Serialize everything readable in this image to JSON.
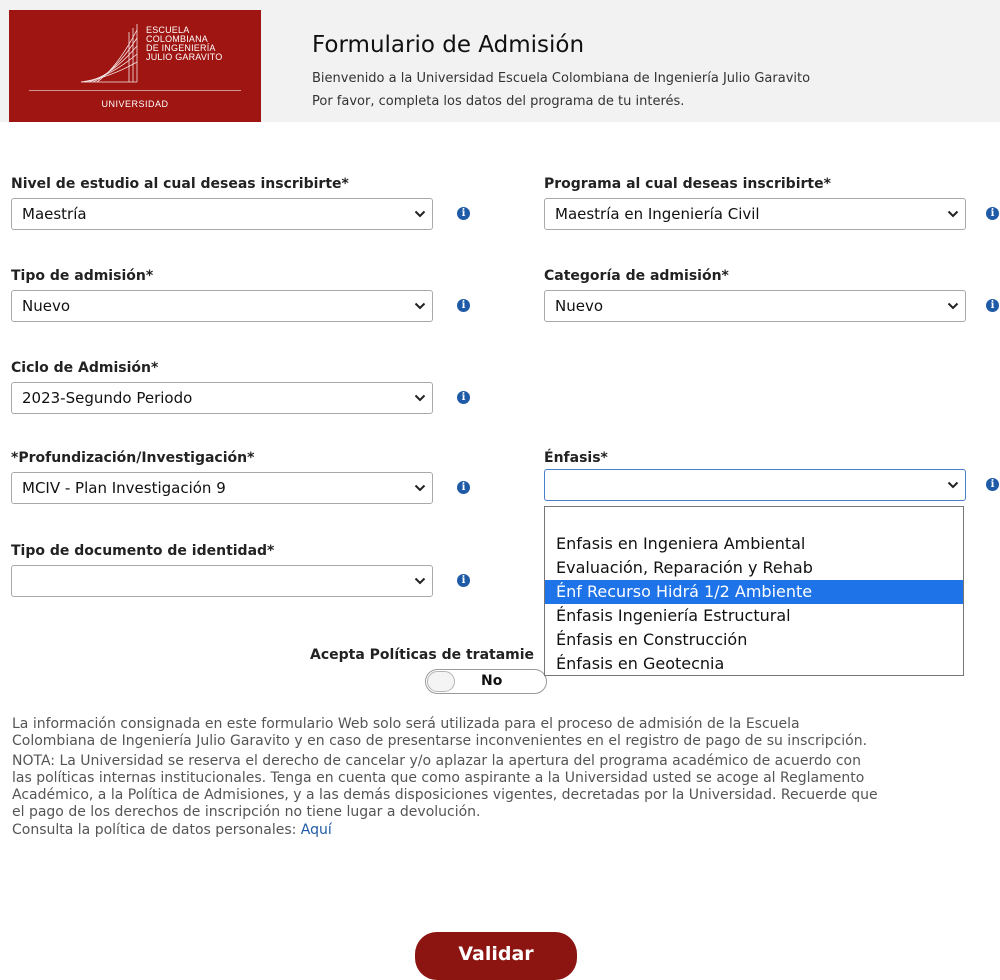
{
  "logo": {
    "lines": [
      "ESCUELA",
      "COLOMBIANA",
      "DE INGENIERÍA",
      "JULIO GARAVITO"
    ],
    "univ": "UNIVERSIDAD"
  },
  "header": {
    "title": "Formulario de Admisión",
    "welcome": "Bienvenido a la Universidad Escuela Colombiana de Ingeniería Julio Garavito",
    "instruction": "Por favor, completa los datos del programa de tu interés."
  },
  "form": {
    "nivel": {
      "label": "Nivel de estudio al cual deseas inscribirte*",
      "value": "Maestría"
    },
    "programa": {
      "label": "Programa al cual deseas inscribirte*",
      "value": "Maestría en Ingeniería Civil"
    },
    "tipo_admision": {
      "label": "Tipo de admisión*",
      "value": "Nuevo"
    },
    "categoria": {
      "label": "Categoría de admisión*",
      "value": "Nuevo"
    },
    "ciclo": {
      "label": "Ciclo de Admisión*",
      "value": "2023-Segundo Periodo"
    },
    "profundizacion": {
      "label": "*Profundización/Investigación*",
      "value": "MCIV - Plan Investigación 9"
    },
    "enfasis": {
      "label": "Énfasis*",
      "value": ""
    },
    "tipo_documento": {
      "label": "Tipo de documento de identidad*",
      "value": ""
    }
  },
  "dropdown": {
    "options": [
      "",
      "Enfasis en Ingeniera Ambiental",
      "Evaluación, Reparación y Rehab",
      "Énf Recurso Hidrá 1/2 Ambiente",
      "Énfasis Ingeniería Estructural",
      "Énfasis en Construcción",
      "Énfasis en Geotecnia"
    ],
    "highlighted": "Énf Recurso Hidrá 1/2 Ambiente"
  },
  "accept": {
    "label": "Acepta Políticas de tratamie",
    "toggle": "No"
  },
  "info_text": {
    "p1": [
      "La información consignada en este formulario Web solo será utilizada para el proceso de admisión de la Escuela",
      "Colombiana de Ingeniería Julio Garavito y en caso de presentarse inconvenientes en el registro de pago de su inscripción."
    ],
    "p2": [
      "NOTA: La Universidad se reserva el derecho de cancelar y/o aplazar la apertura del programa académico de acuerdo con",
      "las políticas internas institucionales. Tenga en cuenta que como aspirante a la Universidad usted se acoge al Reglamento",
      "Académico, a la Política de Admisiones, y a las demás disposiciones vigentes, decretadas por la Universidad. Recuerde que",
      "el pago de los derechos de inscripción no tiene lugar a devolución."
    ],
    "policy_label": "Consulta la política de datos personales:",
    "policy_link": "Aquí"
  },
  "buttons": {
    "validate": "Validar"
  },
  "icons": {
    "info": "info-circle-icon",
    "chevron": "chevron-down-icon"
  },
  "colors": {
    "brand": "#9e1512",
    "button": "#8c1411",
    "highlight": "#1e73e8",
    "info": "#1f5aa6"
  }
}
